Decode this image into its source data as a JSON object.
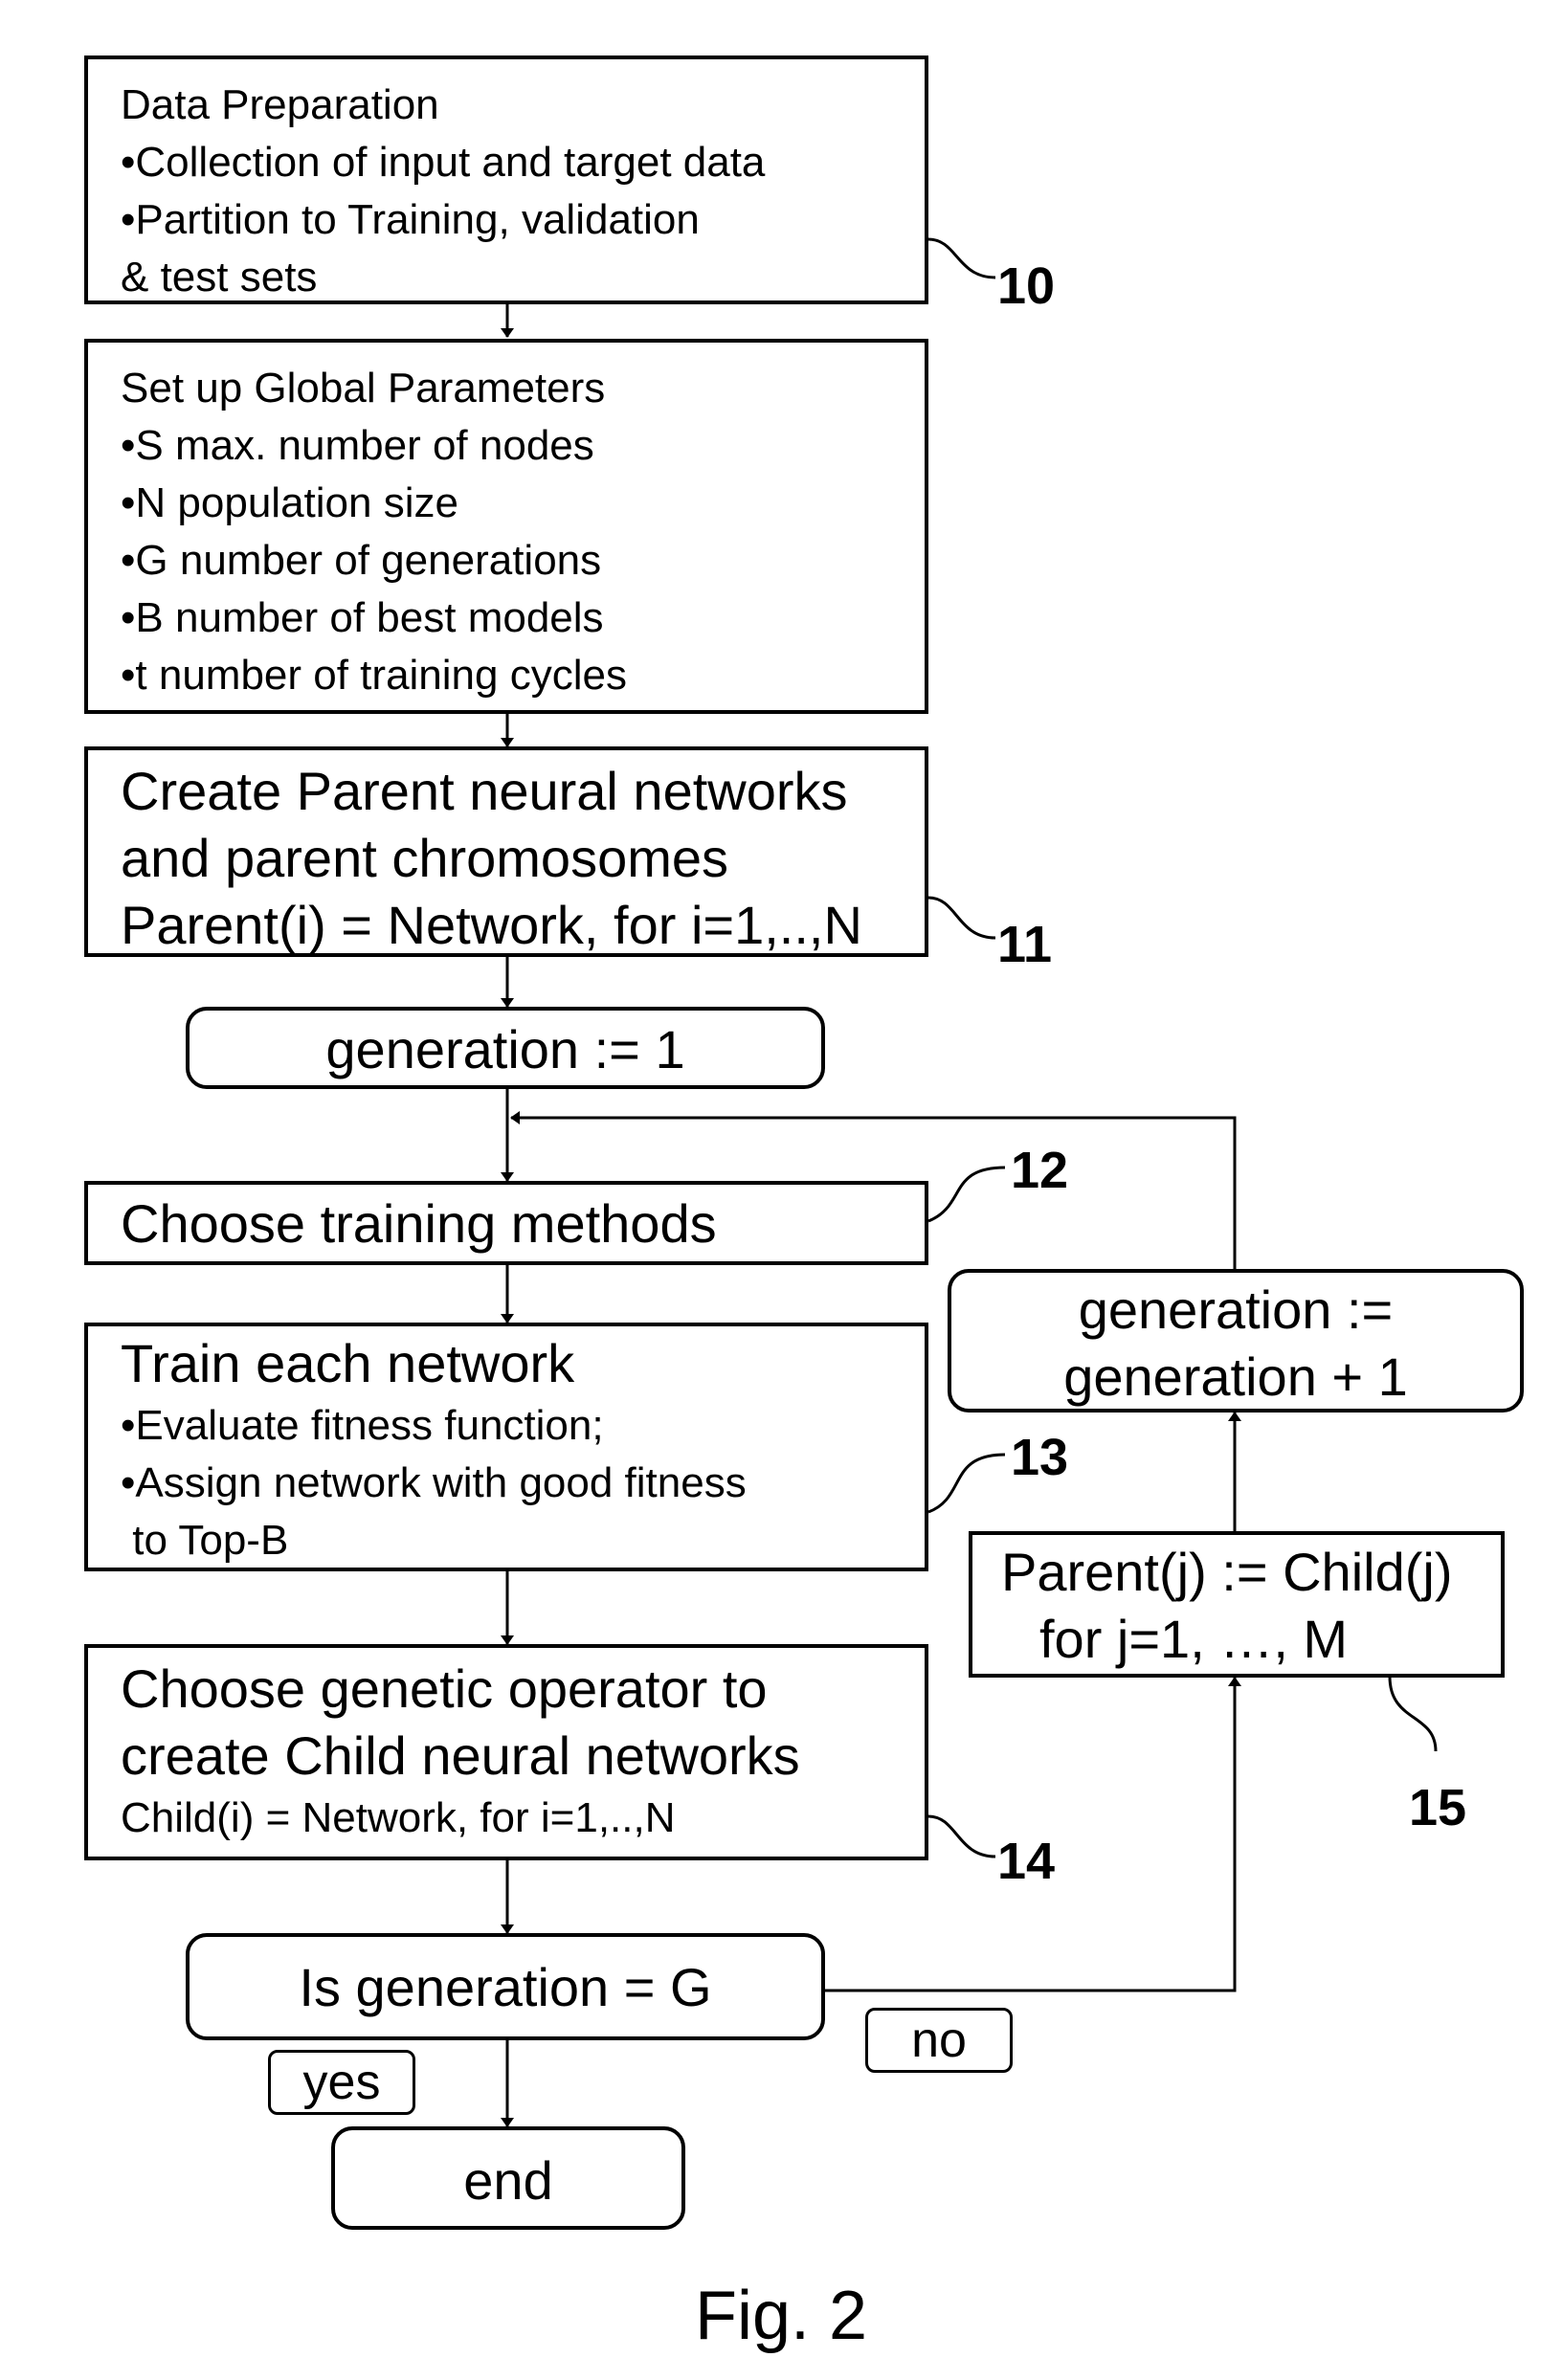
{
  "figure": {
    "caption": "Fig. 2",
    "nodes": {
      "data_preparation": {
        "ref": "10",
        "lines": [
          "Data Preparation",
          "•Collection of input and target data",
          "•Partition to Training, validation",
          "& test sets"
        ]
      },
      "global_parameters": {
        "lines": [
          "Set up Global  Parameters",
          "•S   max. number of nodes",
          "•N   population size",
          "•G   number of generations",
          "•B   number of best models",
          "•t   number of training cycles"
        ]
      },
      "create_parents": {
        "ref": "11",
        "lines": [
          "Create Parent neural networks",
          "and parent chromosomes",
          "Parent(i) = Network, for i=1,..,N"
        ]
      },
      "generation_init": {
        "text": "generation := 1"
      },
      "choose_training": {
        "ref": "12",
        "text": "Choose training methods"
      },
      "train_network": {
        "ref": "13",
        "title": "Train each network",
        "lines": [
          "•Evaluate fitness function;",
          "•Assign network with good fitness",
          " to Top-B"
        ]
      },
      "genetic_operator": {
        "ref": "14",
        "lines": [
          "Choose genetic operator to",
          "create Child neural networks"
        ],
        "sub": "Child(i) = Network, for i=1,..,N"
      },
      "decision": {
        "text": "Is generation = G",
        "yes_label": "yes",
        "no_label": "no"
      },
      "end": {
        "text": "end"
      },
      "increment": {
        "lines": [
          "generation :=",
          "generation + 1"
        ]
      },
      "replace_parents": {
        "ref": "15",
        "lines": [
          "Parent(j) := Child(j)",
          "for j=1, …, M"
        ]
      }
    }
  }
}
